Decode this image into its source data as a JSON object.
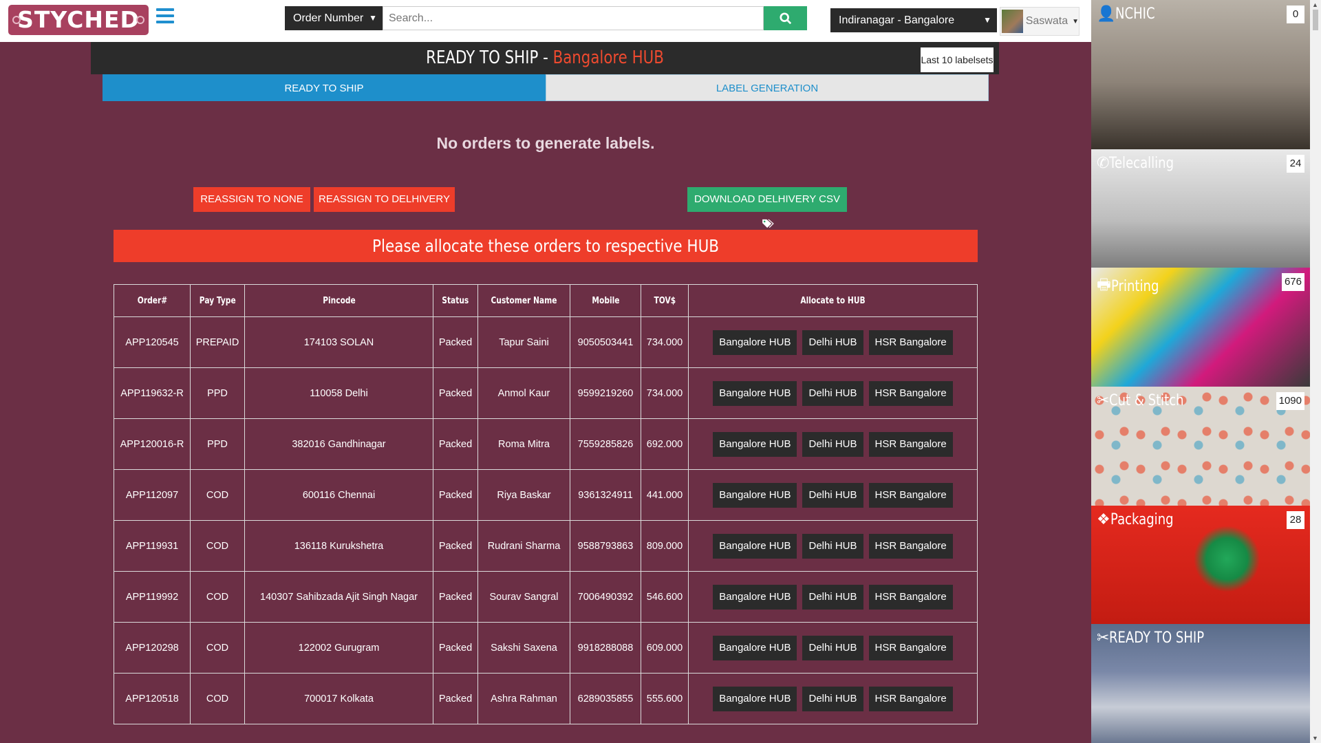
{
  "brand": {
    "logo_text": "STYCHED"
  },
  "search": {
    "type_selected": "Order Number",
    "placeholder": "Search...",
    "location_selected": "Indiranagar - Bangalore",
    "user_name": "Saswata"
  },
  "header": {
    "title_prefix": "READY TO SHIP - ",
    "title_hub": "Bangalore HUB",
    "last_labelsets": "Last 10 labelsets"
  },
  "tabs": [
    {
      "label": "READY TO SHIP"
    },
    {
      "label": "LABEL GENERATION"
    }
  ],
  "empty_message": "No orders to generate labels.",
  "actions": {
    "reassign_none": "REASSIGN TO NONE",
    "reassign_delhivery": "REASSIGN TO DELHIVERY",
    "download_csv": "DOWNLOAD DELHIVERY CSV"
  },
  "alert": "Please allocate these orders to respective HUB",
  "table": {
    "columns": [
      "Order#",
      "Pay Type",
      "Pincode",
      "Status",
      "Customer Name",
      "Mobile",
      "TOV$",
      "Allocate to HUB"
    ],
    "hub_buttons": [
      "Bangalore HUB",
      "Delhi HUB",
      "HSR Bangalore"
    ],
    "rows": [
      {
        "order": "APP120545",
        "pay": "PREPAID",
        "pincode": "174103 SOLAN",
        "status": "Packed",
        "customer": "Tapur Saini",
        "mobile": "9050503441",
        "tov": "734.000"
      },
      {
        "order": "APP119632-R",
        "pay": "PPD",
        "pincode": "110058 Delhi",
        "status": "Packed",
        "customer": "Anmol Kaur",
        "mobile": "9599219260",
        "tov": "734.000"
      },
      {
        "order": "APP120016-R",
        "pay": "PPD",
        "pincode": "382016 Gandhinagar",
        "status": "Packed",
        "customer": "Roma Mitra",
        "mobile": "7559285826",
        "tov": "692.000"
      },
      {
        "order": "APP112097",
        "pay": "COD",
        "pincode": "600116 Chennai",
        "status": "Packed",
        "customer": "Riya Baskar",
        "mobile": "9361324911",
        "tov": "441.000"
      },
      {
        "order": "APP119931",
        "pay": "COD",
        "pincode": "136118 Kurukshetra",
        "status": "Packed",
        "customer": "Rudrani Sharma",
        "mobile": "9588793863",
        "tov": "809.000"
      },
      {
        "order": "APP119992",
        "pay": "COD",
        "pincode": "140307 Sahibzada Ajit Singh Nagar",
        "status": "Packed",
        "customer": "Sourav Sangral",
        "mobile": "7006490392",
        "tov": "546.600"
      },
      {
        "order": "APP120298",
        "pay": "COD",
        "pincode": "122002 Gurugram",
        "status": "Packed",
        "customer": "Sakshi Saxena",
        "mobile": "9918288088",
        "tov": "609.000"
      },
      {
        "order": "APP120518",
        "pay": "COD",
        "pincode": "700017 Kolkata",
        "status": "Packed",
        "customer": "Ashra Rahman",
        "mobile": "6289035855",
        "tov": "555.600"
      }
    ]
  },
  "sidebar": [
    {
      "label": "NCHIC",
      "count": "0",
      "icon": "user-icon"
    },
    {
      "label": "Telecalling",
      "count": "24",
      "icon": "phone-icon"
    },
    {
      "label": "Printing",
      "count": "676",
      "icon": "printer-icon"
    },
    {
      "label": "Cut & Stitch",
      "count": "1090",
      "icon": "scissors-icon"
    },
    {
      "label": "Packaging",
      "count": "28",
      "icon": "cubes-icon"
    },
    {
      "label": "READY TO SHIP",
      "count": "",
      "icon": "scissors-icon"
    }
  ],
  "colors": {
    "background": "#6b2f45",
    "accent_blue": "#1e8fcb",
    "accent_red": "#ee3d2a",
    "accent_green": "#2eab6f",
    "logo": "#a8415f"
  }
}
